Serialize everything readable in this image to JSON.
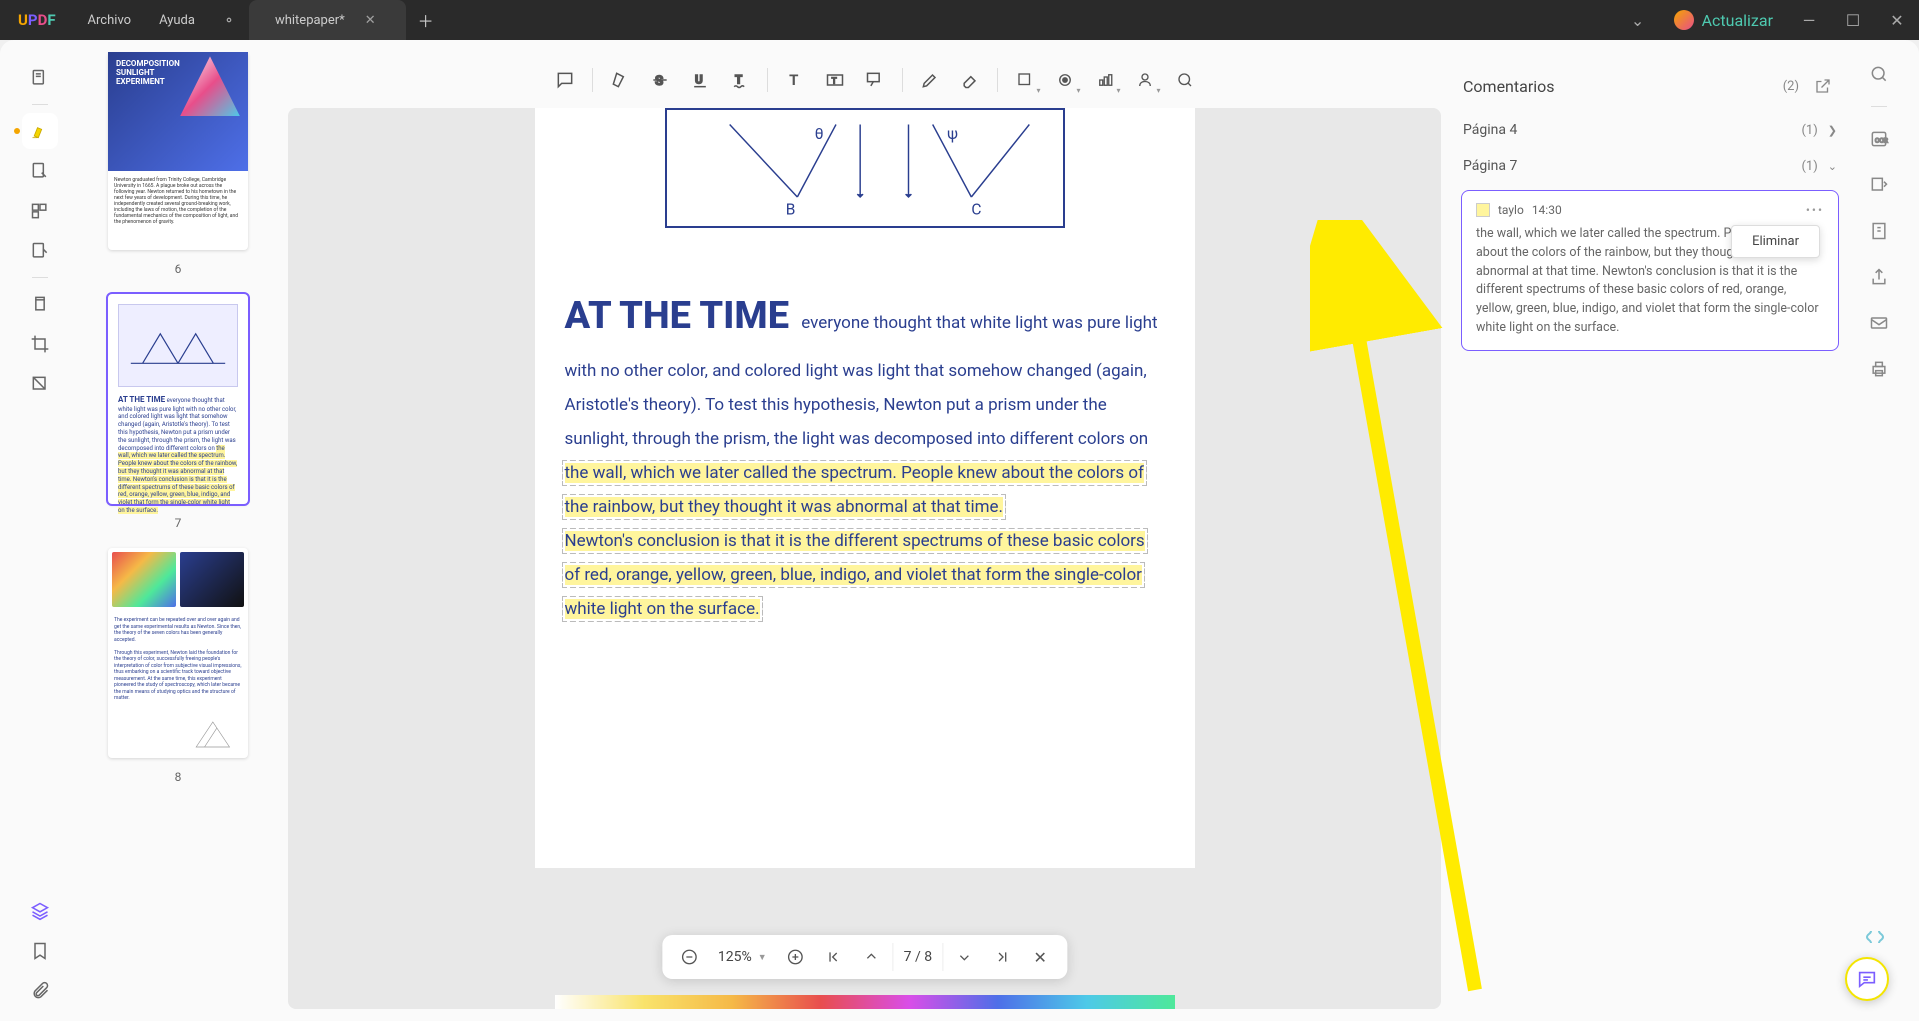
{
  "titlebar": {
    "menus": [
      "Archivo",
      "Ayuda"
    ],
    "tab_title": "whitepaper*",
    "upgrade_label": "Actualizar"
  },
  "thumbnails": [
    {
      "num": "6",
      "selected": false
    },
    {
      "num": "7",
      "selected": true
    },
    {
      "num": "8",
      "selected": false
    }
  ],
  "document": {
    "heading": "AT THE TIME",
    "paragraph_plain": "everyone thought that white light was pure light with no other color, and colored light was light that somehow changed (again, Aristotle's theory). To test this hypothesis, Newton put a prism under the sunlight, through the prism, the light was decomposed into different colors on ",
    "hl1": "the wall, which we later called the spectrum. People knew about the colors of the rainbow, but they thought it was abnormal at that time.",
    "hl2": "Newton's conclusion is that it is the different spectrums of these basic colors of red, orange, yellow, green, blue, indigo, and violet that form the single-color white light on the surface.",
    "diagram_labels": {
      "theta": "θ",
      "psi": "ψ",
      "B": "B",
      "C": "C"
    }
  },
  "page_nav": {
    "zoom": "125%",
    "page": "7",
    "sep": "/",
    "total": "8"
  },
  "comments": {
    "title": "Comentarios",
    "total_count": "(2)",
    "groups": [
      {
        "label": "Página 4",
        "count": "(1)",
        "expanded": false
      },
      {
        "label": "Página 7",
        "count": "(1)",
        "expanded": true
      }
    ],
    "card": {
      "author": "taylo",
      "time": "14:30",
      "text": "the wall, which we later called the spectrum. People knew about the colors of the rainbow, but they thought it was abnormal at that time. Newton's conclusion is that it is the different spectrums of these basic colors of red, orange, yellow, green, blue, indigo, and violet that form the single-color white light on the surface."
    },
    "context_menu_label": "Eliminar"
  }
}
